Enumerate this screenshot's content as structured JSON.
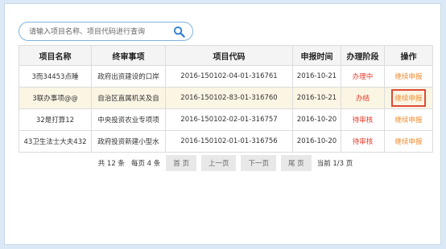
{
  "search": {
    "placeholder": "请输入项目名称、项目代码进行查询",
    "value": ""
  },
  "table": {
    "headers": [
      "项目名称",
      "终审事项",
      "项目代码",
      "申报时间",
      "办理阶段",
      "操作"
    ],
    "rows": [
      {
        "name": "3而34453点睡",
        "matter": "政府出资建设的口岸",
        "code": "2016-150102-04-01-316761",
        "date": "2016-10-21",
        "stage": "办理中",
        "action": "继续申报"
      },
      {
        "name": "3联办事项@@",
        "matter": "自治区直属机关及自",
        "code": "2016-150102-83-01-316760",
        "date": "2016-10-21",
        "stage": "办结",
        "action": "继续申报"
      },
      {
        "name": "32是打算12",
        "matter": "中央投资农业专项项",
        "code": "2016-150102-02-01-316757",
        "date": "2016-10-20",
        "stage": "待审核",
        "action": "继续申报"
      },
      {
        "name": "43卫生法士大夫432",
        "matter": "政府投资新建小型水",
        "code": "2016-150102-01-01-316756",
        "date": "2016-10-20",
        "stage": "待审核",
        "action": "继续申报"
      }
    ]
  },
  "pager": {
    "total": "共 12 条",
    "per_page": "每页 4 条",
    "first": "首 页",
    "prev": "上一页",
    "next": "下一页",
    "last": "尾 页",
    "current": "当前 1/3 页"
  },
  "colors": {
    "status": "#e23a2a",
    "action": "#f08a2a",
    "selected_row": "#fbf5e4",
    "highlight_border": "#e04a3a"
  }
}
